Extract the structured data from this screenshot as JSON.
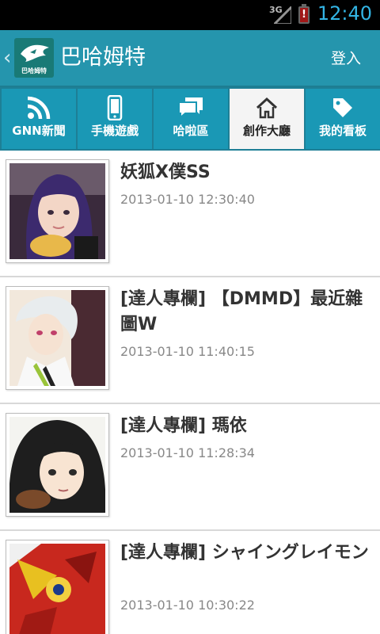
{
  "status": {
    "network": "3G",
    "time": "12:40"
  },
  "appbar": {
    "title": "巴哈姆特",
    "logo_text": "巴哈姆特",
    "login": "登入"
  },
  "tabs": [
    {
      "label": "GNN新聞",
      "icon": "rss-icon"
    },
    {
      "label": "手機遊戲",
      "icon": "phone-icon"
    },
    {
      "label": "哈啦區",
      "icon": "chat-icon"
    },
    {
      "label": "創作大廳",
      "icon": "home-icon",
      "active": true
    },
    {
      "label": "我的看板",
      "icon": "tag-icon"
    }
  ],
  "articles": [
    {
      "title": "妖狐X僕SS",
      "date": "2013-01-10 12:30:40"
    },
    {
      "title": "[達人專欄] 【DMMD】最近雜圖W",
      "date": "2013-01-10 11:40:15"
    },
    {
      "title": "[達人專欄] 瑪依",
      "date": "2013-01-10 11:28:34"
    },
    {
      "title": "[達人專欄] シャイングレイモン",
      "date": "2013-01-10 10:30:22"
    }
  ],
  "colors": {
    "appbar": "#2595ad",
    "tab": "#1a98b5",
    "tab_active": "#f4f4f4",
    "clock": "#33b5e5"
  }
}
